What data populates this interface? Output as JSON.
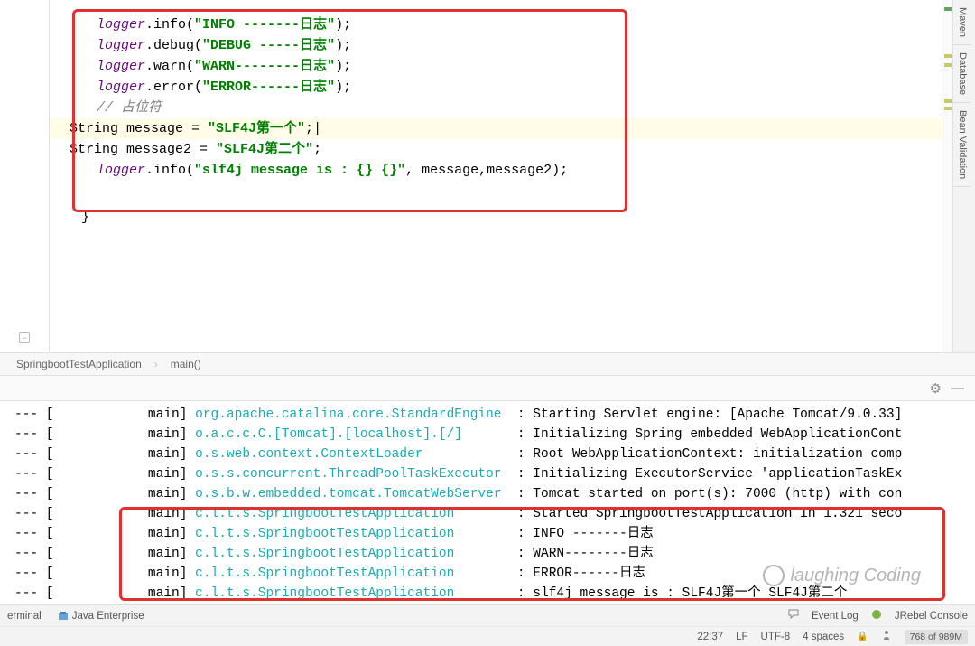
{
  "editor": {
    "lines": [
      {
        "obj": "logger",
        "method": ".info(",
        "str": "\"INFO -------日志\"",
        "tail": ");"
      },
      {
        "obj": "logger",
        "method": ".debug(",
        "str": "\"DEBUG -----日志\"",
        "tail": ");"
      },
      {
        "obj": "logger",
        "method": ".warn(",
        "str": "\"WARN--------日志\"",
        "tail": ");"
      },
      {
        "obj": "logger",
        "method": ".error(",
        "str": "\"ERROR------日志\"",
        "tail": ");"
      }
    ],
    "comment": "// 占位符",
    "decl1_type": "String ",
    "decl1_name": "message = ",
    "decl1_val": "\"SLF4J第一个\"",
    "decl1_tail": ";",
    "decl1_cursor": "|",
    "decl2_type": "String ",
    "decl2_name": "message2 = ",
    "decl2_val": "\"SLF4J第二个\"",
    "decl2_tail": ";",
    "last_obj": "logger",
    "last_method": ".info(",
    "last_str": "\"slf4j message is : {} {}\"",
    "last_args": ", message,message2);",
    "closing": "}"
  },
  "breadcrumb": {
    "class": "SpringbootTestApplication",
    "sep": "›",
    "method": "main()"
  },
  "right_tools": [
    "Maven",
    "Database",
    "Bean Validation"
  ],
  "console_rows": [
    {
      "p": "--- [            main] ",
      "c": "org.apache.catalina.core.StandardEngine ",
      "m": " : Starting Servlet engine: [Apache Tomcat/9.0.33]"
    },
    {
      "p": "--- [            main] ",
      "c": "o.a.c.c.C.[Tomcat].[localhost].[/]      ",
      "m": " : Initializing Spring embedded WebApplicationCont"
    },
    {
      "p": "--- [            main] ",
      "c": "o.s.web.context.ContextLoader           ",
      "m": " : Root WebApplicationContext: initialization comp"
    },
    {
      "p": "--- [            main] ",
      "c": "o.s.s.concurrent.ThreadPoolTaskExecutor ",
      "m": " : Initializing ExecutorService 'applicationTaskEx"
    },
    {
      "p": "--- [            main] ",
      "c": "o.s.b.w.embedded.tomcat.TomcatWebServer ",
      "m": " : Tomcat started on port(s): 7000 (http) with con"
    },
    {
      "p": "--- [            main] ",
      "c": "c.l.t.s.SpringbootTestApplication       ",
      "m": " : Started SpringbootTestApplication in 1.321 seco"
    },
    {
      "p": "--- [            main] ",
      "c": "c.l.t.s.SpringbootTestApplication       ",
      "m": " : INFO -------日志"
    },
    {
      "p": "--- [            main] ",
      "c": "c.l.t.s.SpringbootTestApplication       ",
      "m": " : WARN--------日志"
    },
    {
      "p": "--- [            main] ",
      "c": "c.l.t.s.SpringbootTestApplication       ",
      "m": " : ERROR------日志"
    },
    {
      "p": "--- [            main] ",
      "c": "c.l.t.s.SpringbootTestApplication       ",
      "m": " : slf4j message is : SLF4J第一个 SLF4J第二个"
    }
  ],
  "bottom1": {
    "terminal": "erminal",
    "java_e": "Java Enterprise",
    "event_log": "Event Log",
    "jrebel": "JRebel Console"
  },
  "bottom2": {
    "time": "22:37",
    "lf": "LF",
    "enc": "UTF-8",
    "indent": "4 spaces",
    "mem": "768 of 989M"
  },
  "watermark": "laughing Coding"
}
